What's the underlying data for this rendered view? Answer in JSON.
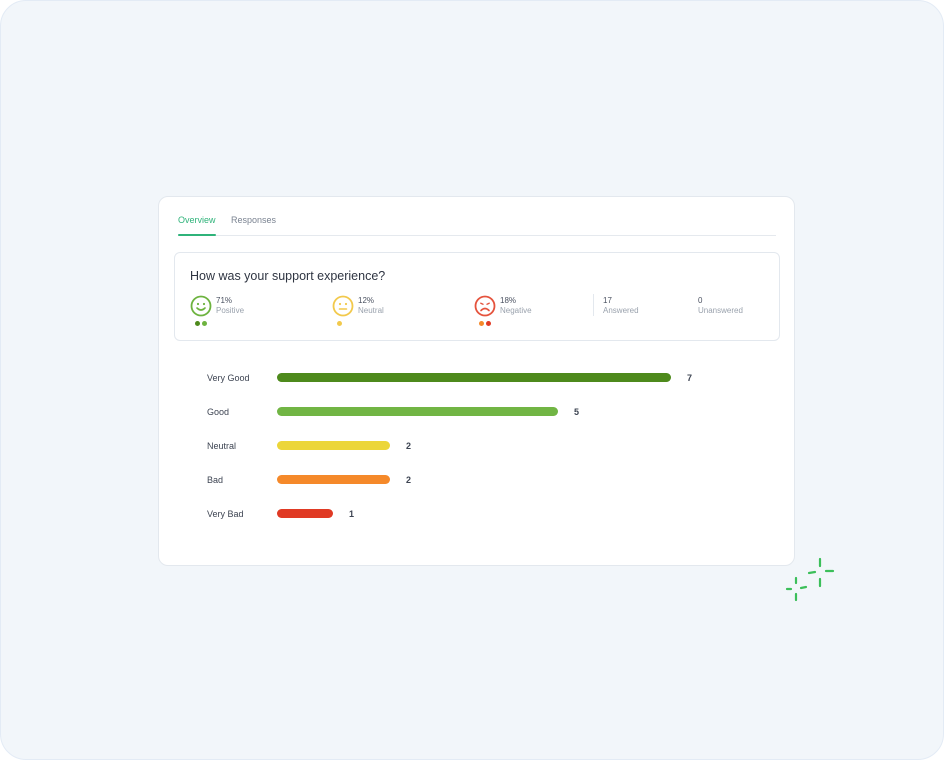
{
  "tabs": [
    {
      "label": "Overview",
      "active": true
    },
    {
      "label": "Responses",
      "active": false
    }
  ],
  "question": "How was your support experience?",
  "summary": [
    {
      "percent": "71%",
      "label": "Positive",
      "color": "#6db33f",
      "icon": "smile-face-icon",
      "dots": [
        "#4e8a1c",
        "#6db33f"
      ]
    },
    {
      "percent": "12%",
      "label": "Neutral",
      "color": "#f2c94c",
      "icon": "neutral-face-icon",
      "dots": [
        "#f2c94c"
      ]
    },
    {
      "percent": "18%",
      "label": "Negative",
      "color": "#e5533d",
      "icon": "sad-face-icon",
      "dots": [
        "#f5892a",
        "#e03a24"
      ]
    }
  ],
  "counts": [
    {
      "value": "17",
      "label": "Answered"
    },
    {
      "value": "0",
      "label": "Unanswered"
    }
  ],
  "chart_data": {
    "type": "bar",
    "orientation": "horizontal",
    "categories": [
      "Very Good",
      "Good",
      "Neutral",
      "Bad",
      "Very Bad"
    ],
    "values": [
      7,
      5,
      2,
      2,
      1
    ],
    "colors": [
      "#4e8a1c",
      "#71b544",
      "#ecd63a",
      "#f5892a",
      "#e03a24"
    ],
    "xlim": [
      0,
      7
    ],
    "grid": false
  }
}
